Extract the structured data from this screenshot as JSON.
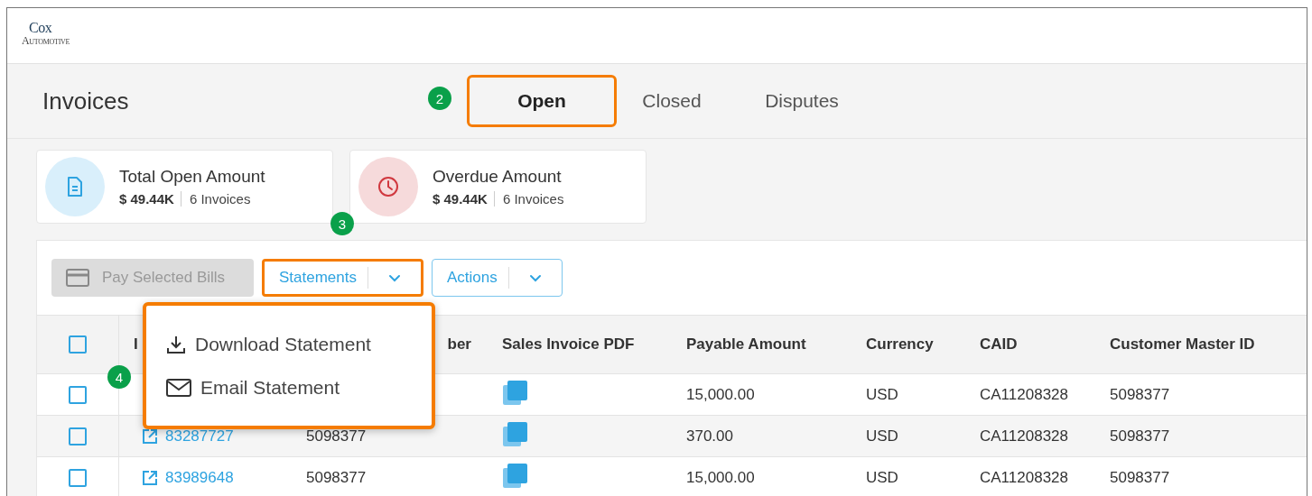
{
  "logo": {
    "line_1": "Cox",
    "line_2": "Automotive"
  },
  "page_title": "Invoices",
  "tabs": [
    {
      "label": "Open",
      "selected": true,
      "highlighted": true,
      "marker": "2"
    },
    {
      "label": "Closed",
      "selected": false,
      "highlighted": false
    },
    {
      "label": "Disputes",
      "selected": false,
      "highlighted": false
    }
  ],
  "summary_cards": [
    {
      "kind": "document",
      "title": "Total Open Amount",
      "amount": "$ 49.44K",
      "count": "6 Invoices"
    },
    {
      "kind": "clock",
      "title": "Overdue Amount",
      "amount": "$ 49.44K",
      "count": "6 Invoices"
    }
  ],
  "toolbar": [
    {
      "kind": "plain",
      "label": "Pay Selected Bills",
      "disabled": true,
      "highlighted": false
    },
    {
      "kind": "split",
      "label": "Statements",
      "disabled": false,
      "highlighted": true,
      "marker": "3"
    },
    {
      "kind": "split",
      "label": "Actions",
      "disabled": false,
      "highlighted": false
    }
  ],
  "statements_menu": {
    "highlighted": true,
    "marker": "4",
    "items": [
      {
        "kind": "download",
        "label": "Download Statement"
      },
      {
        "kind": "email",
        "label": "Email Statement"
      }
    ]
  },
  "table": {
    "select_all": false,
    "columns": [
      "I",
      "ber",
      "Sales Invoice PDF",
      "Payable Amount",
      "Currency",
      "CAID",
      "Customer Master ID"
    ],
    "rows": [
      {
        "checked": false,
        "payable_amount": "15,000.00",
        "currency": "USD",
        "caid": "CA11208328",
        "customer_master_id": "5098377"
      },
      {
        "checked": false,
        "invoice_number": "83287727",
        "customer_number": "5098377",
        "payable_amount": "370.00",
        "currency": "USD",
        "caid": "CA11208328",
        "customer_master_id": "5098377"
      },
      {
        "checked": false,
        "invoice_number": "83989648",
        "customer_number": "5098377",
        "payable_amount": "15,000.00",
        "currency": "USD",
        "caid": "CA11208328",
        "customer_master_id": "5098377"
      }
    ]
  }
}
